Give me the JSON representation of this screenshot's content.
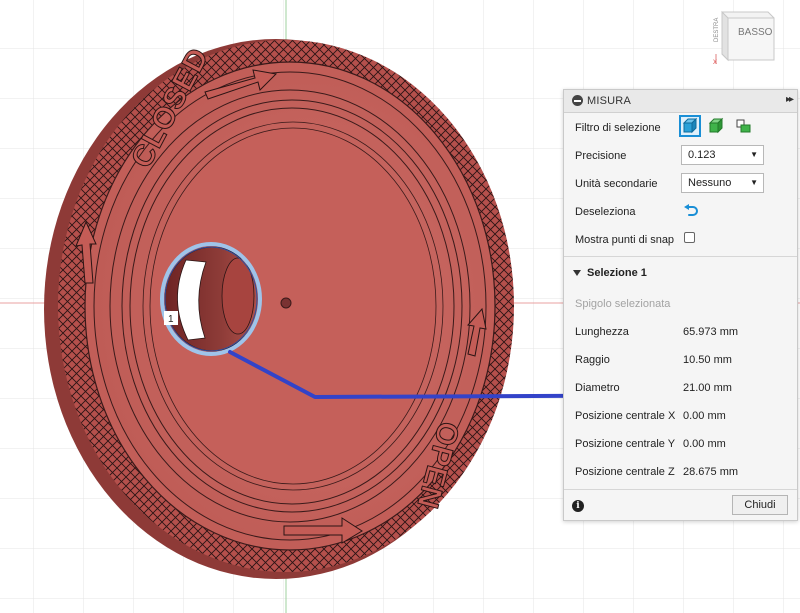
{
  "viewcube": {
    "face_label": "BASSO",
    "side_label": "DESTRA"
  },
  "knob": {
    "label_closed": "CLOSED",
    "label_open": "OPEN",
    "point_marker": "1"
  },
  "colors": {
    "body": "#c15b55",
    "body_dark": "#a84844",
    "highlight": "#3343c9",
    "accent": "#1a8fd6"
  },
  "panel": {
    "title": "MISURA",
    "expand_label": "▸▸",
    "rows": {
      "filter": {
        "label": "Filtro di selezione",
        "icons": [
          "face-filter-icon",
          "body-filter-icon",
          "component-filter-icon"
        ]
      },
      "precision": {
        "label": "Precisione",
        "value": "0.123"
      },
      "secondary_units": {
        "label": "Unità secondarie",
        "value": "Nessuno"
      },
      "deselect": {
        "label": "Deseleziona"
      },
      "snap": {
        "label": "Mostra punti di snap",
        "checked": false
      }
    },
    "selection": {
      "title": "Selezione 1",
      "subtitle": "Spigolo selezionata",
      "measurements": [
        {
          "label": "Lunghezza",
          "value": "65.973 mm"
        },
        {
          "label": "Raggio",
          "value": "10.50 mm"
        },
        {
          "label": "Diametro",
          "value": "21.00 mm"
        },
        {
          "label": "Posizione centrale X",
          "value": "0.00 mm"
        },
        {
          "label": "Posizione centrale Y",
          "value": "0.00 mm"
        },
        {
          "label": "Posizione centrale Z",
          "value": "28.675 mm"
        }
      ]
    },
    "close_label": "Chiudi"
  }
}
